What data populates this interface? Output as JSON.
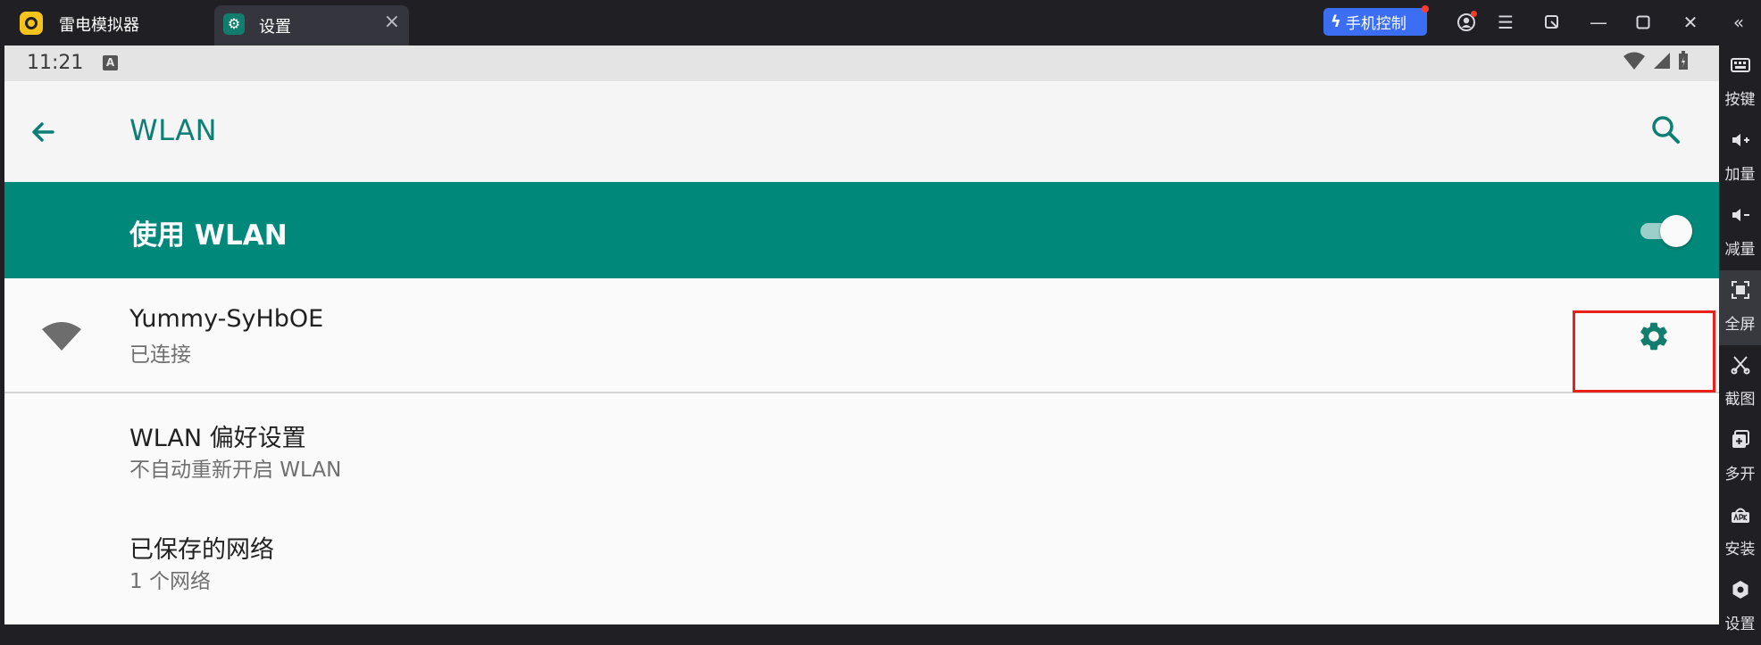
{
  "titlebar": {
    "app_name": "雷电模拟器",
    "tab_label": "设置",
    "phone_control_label": "手机控制",
    "icons": [
      "app-logo-icon",
      "settings-tab-icon",
      "close-icon",
      "lightning-icon",
      "user-icon",
      "menu-icon",
      "multi-window-icon",
      "minimize-icon",
      "maximize-icon",
      "close-window-icon",
      "collapse-sidebar-icon"
    ]
  },
  "statusbar": {
    "time": "11:21",
    "keyboard_indicator": "A"
  },
  "appbar": {
    "title": "WLAN"
  },
  "master_switch": {
    "label": "使用 WLAN",
    "enabled": true
  },
  "networks": [
    {
      "ssid": "Yummy-SyHbOE",
      "status": "已连接"
    }
  ],
  "preferences": [
    {
      "title": "WLAN 偏好设置",
      "subtitle": "不自动重新开启 WLAN"
    },
    {
      "title": "已保存的网络",
      "subtitle": "1 个网络"
    }
  ],
  "sidebar": {
    "items": [
      {
        "label": "按键",
        "icon": "keyboard-icon"
      },
      {
        "label": "加量",
        "icon": "volume-up-icon"
      },
      {
        "label": "减量",
        "icon": "volume-down-icon"
      },
      {
        "label": "全屏",
        "icon": "fullscreen-icon"
      },
      {
        "label": "截图",
        "icon": "scissors-icon"
      },
      {
        "label": "多开",
        "icon": "multi-instance-icon"
      },
      {
        "label": "安装",
        "icon": "apk-icon"
      },
      {
        "label": "设置",
        "icon": "settings-icon"
      }
    ]
  },
  "colors": {
    "teal_primary": "#00897b",
    "teal_text": "#0e7f74",
    "highlight_red": "#e8221b",
    "phone_control_blue": "#3b6ef2"
  }
}
